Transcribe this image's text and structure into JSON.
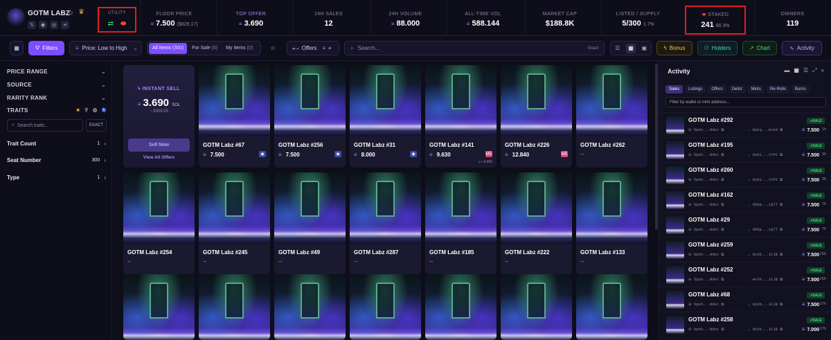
{
  "collection": {
    "name": "GOTM LABZ",
    "socials": [
      "x-icon",
      "discord-icon",
      "globe-icon",
      "share-icon"
    ]
  },
  "stats": {
    "utility_label": "UTILITY",
    "floor": {
      "label": "FLOOR PRICE",
      "value": "7.500",
      "sub": "($629.17)"
    },
    "top_offer": {
      "label": "TOP OFFER",
      "value": "3.690"
    },
    "sales_24h": {
      "label": "24H SALES",
      "value": "12"
    },
    "volume_24h": {
      "label": "24H VOLUME",
      "value": "88.000"
    },
    "all_time_vol": {
      "label": "ALL-TIME VOL",
      "value": "588.144"
    },
    "market_cap": {
      "label": "MARKET CAP",
      "value": "$188.8K"
    },
    "listed": {
      "label": "LISTED / SUPPLY",
      "value": "5/300",
      "sub": "1.7%"
    },
    "staked": {
      "label": "STAKED",
      "value": "241",
      "sub": "80.3%"
    },
    "owners": {
      "label": "OWNERS",
      "value": "119"
    }
  },
  "toolbar": {
    "filters_label": "Filters",
    "sort_label": "Price: Low to High",
    "tabs": [
      {
        "label": "All Items",
        "count": "(300)"
      },
      {
        "label": "For Sale",
        "count": "(5)"
      },
      {
        "label": "My Items",
        "count": "(0)"
      }
    ],
    "offers_label": "Offers",
    "search_placeholder": "Search...",
    "search_exact": "Exact",
    "bonus_label": "Bonus",
    "holders_label": "Holders",
    "chart_label": "Chart",
    "activity_label": "Activity"
  },
  "sidebar": {
    "price_range": "PRICE RANGE",
    "source": "SOURCE",
    "rarity_rank": "RARITY RANK",
    "traits": "TRAITS",
    "trait_search_placeholder": "Search traits...",
    "exact_label": "EXACT",
    "items": [
      {
        "label": "Trait Count",
        "count": "1"
      },
      {
        "label": "Seat Number",
        "count": "300"
      },
      {
        "label": "Type",
        "count": "1"
      }
    ]
  },
  "instant_sell": {
    "title": "INSTANT SELL",
    "price": "3.690",
    "unit": "SOL",
    "usd": "~ $309.55",
    "button": "Sell Now",
    "view_all": "View All Offers"
  },
  "cards": [
    {
      "name": "GOTM Labz #67",
      "price": "7.500",
      "market": "tensor"
    },
    {
      "name": "GOTM Labz #256",
      "price": "7.500",
      "market": "tensor"
    },
    {
      "name": "GOTM Labz #31",
      "price": "8.000",
      "market": "tensor"
    },
    {
      "name": "GOTM Labz #141",
      "price": "9.630",
      "market": "me",
      "last": "6.000"
    },
    {
      "name": "GOTM Labz #226",
      "price": "12.840",
      "market": "me"
    },
    {
      "name": "GOTM Labz #262",
      "price": "--"
    },
    {
      "name": "GOTM Labz #254",
      "price": "--"
    },
    {
      "name": "GOTM Labz #245",
      "price": "--"
    },
    {
      "name": "GOTM Labz #49",
      "price": "--"
    },
    {
      "name": "GOTM Labz #287",
      "price": "--"
    },
    {
      "name": "GOTM Labz #185",
      "price": "--"
    },
    {
      "name": "GOTM Labz #222",
      "price": "--"
    },
    {
      "name": "GOTM Labz #133",
      "price": "--"
    }
  ],
  "activity": {
    "title": "Activity",
    "tabs": [
      "Sales",
      "Listings",
      "Offers",
      "Delist",
      "Mints",
      "Re-Rolls",
      "Burns"
    ],
    "filter_placeholder": "Filter by wallet or mint address...",
    "rows": [
      {
        "name": "GOTM Labz #292",
        "from": "5psh...Ndvc",
        "to": "8qtq...Kzed",
        "price": "7.500",
        "ago": "1h",
        "type": "SALE"
      },
      {
        "name": "GOTM Labz #195",
        "from": "5psh...Ndvc",
        "to": "Dubi...tYP2",
        "price": "7.500",
        "ago": "3h",
        "type": "SALE"
      },
      {
        "name": "GOTM Labz #260",
        "from": "5psh...Ndvc",
        "to": "Dubi...tYP2",
        "price": "7.500",
        "ago": "3h",
        "type": "SALE"
      },
      {
        "name": "GOTM Labz #162",
        "from": "5psh...Ndvc",
        "to": "6Dbp...1Q7T",
        "price": "7.500",
        "ago": "7h",
        "type": "SALE"
      },
      {
        "name": "GOTM Labz #29",
        "from": "5psh...Ndvc",
        "to": "6Dbp...1Q7T",
        "price": "7.500",
        "ago": "7h",
        "type": "SALE"
      },
      {
        "name": "GOTM Labz #259",
        "from": "5psh...Ndvc",
        "to": "Hv2b...iCJB",
        "price": "7.500",
        "ago": "16h",
        "type": "SALE"
      },
      {
        "name": "GOTM Labz #252",
        "from": "5psh...Ndvc",
        "to": "Hv2b...iCJB",
        "price": "7.500",
        "ago": "16h",
        "type": "SALE"
      },
      {
        "name": "GOTM Labz #68",
        "from": "5psh...Ndvc",
        "to": "Hv2b...iCJB",
        "price": "7.500",
        "ago": "17h",
        "type": "SALE"
      },
      {
        "name": "GOTM Labz #258",
        "from": "5psh...Ndvc",
        "to": "Hv2b...iCJB",
        "price": "7.000",
        "ago": "17h",
        "type": "SALE"
      }
    ]
  },
  "colors": {
    "accent": "#7c4dff",
    "sale": "#4ade80",
    "highlight_box": "#e02020"
  }
}
